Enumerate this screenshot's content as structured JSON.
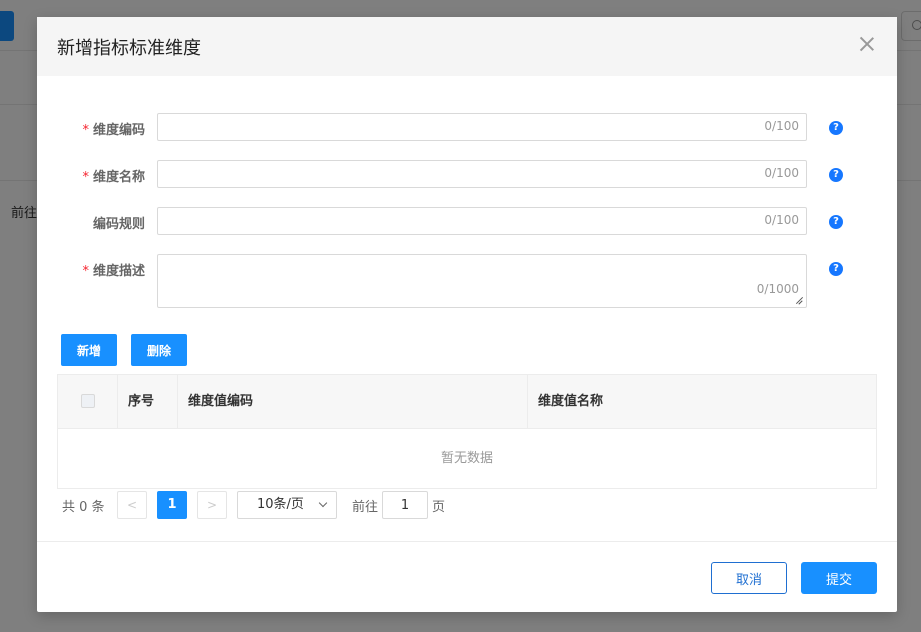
{
  "background": {
    "partial_text": "前往"
  },
  "dialog": {
    "title": "新增指标标准维度",
    "close_icon": "close-icon"
  },
  "form": {
    "fields": [
      {
        "label": "维度编码",
        "required": true,
        "value": "",
        "counter": "0/100"
      },
      {
        "label": "维度名称",
        "required": true,
        "value": "",
        "counter": "0/100"
      },
      {
        "label": "编码规则",
        "required": false,
        "value": "",
        "counter": "0/100"
      },
      {
        "label": "维度描述",
        "required": true,
        "value": "",
        "counter": "0/1000"
      }
    ],
    "help_icon": "question-circle-icon",
    "required_mark": "*"
  },
  "toolbar": {
    "add_label": "新增",
    "delete_label": "删除"
  },
  "table": {
    "columns": [
      "序号",
      "维度值编码",
      "维度值名称"
    ],
    "rows": [],
    "empty_text": "暂无数据"
  },
  "pagination": {
    "total_text": "共 0 条",
    "prev_label": "<",
    "current_page": "1",
    "next_label": ">",
    "page_size": "10条/页",
    "goto_label": "前往",
    "goto_value": "1",
    "page_unit": "页"
  },
  "footer": {
    "cancel_label": "取消",
    "submit_label": "提交"
  },
  "colors": {
    "primary": "#1890ff",
    "required": "#f5222d",
    "help_icon": "#1677ff"
  }
}
